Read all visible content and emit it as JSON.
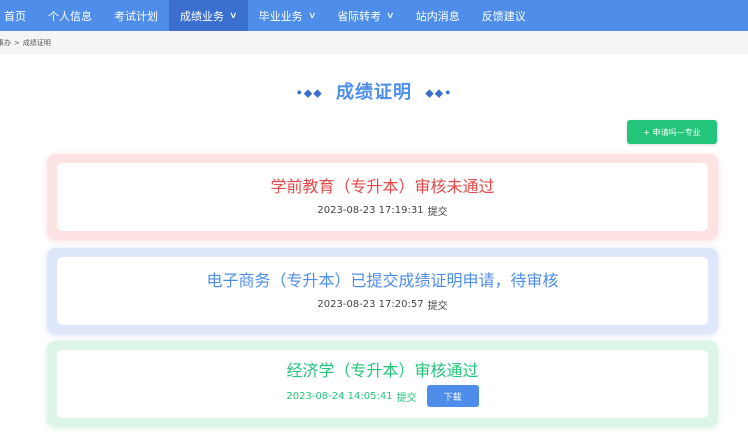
{
  "nav": {
    "items": [
      {
        "label": "首页"
      },
      {
        "label": "个人信息"
      },
      {
        "label": "考试计划"
      },
      {
        "label": "成绩业务"
      },
      {
        "label": "毕业业务"
      },
      {
        "label": "省际转考"
      },
      {
        "label": "站内消息"
      },
      {
        "label": "反馈建议"
      }
    ],
    "chevron": "∨",
    "active_color": "#3a6fd0",
    "bar_color": "#4e8eea"
  },
  "breadcrumb": {
    "first": "事办",
    "separator": ">",
    "current": "成绩证明"
  },
  "page": {
    "title": "成绩证明",
    "deco_left": "•◆◆",
    "deco_right": "◆◆•",
    "apply_button": "+ 申请吗—专业"
  },
  "records": [
    {
      "title": "学前教育（专升本）审核未通过",
      "time": "2023-08-23 17:19:31",
      "action": "提交",
      "status": "rejected",
      "color": "#e54a4a"
    },
    {
      "title": "电子商务（专升本）已提交成绩证明申请，待审核",
      "time": "2023-08-23 17:20:57",
      "action": "提交",
      "status": "pending",
      "color": "#4e8eea"
    },
    {
      "title": "经济学（专升本）审核通过",
      "time": "2023-08-24 14:05:41",
      "action": "提交",
      "status": "approved",
      "color": "#22c57a",
      "download_label": "下载"
    }
  ]
}
